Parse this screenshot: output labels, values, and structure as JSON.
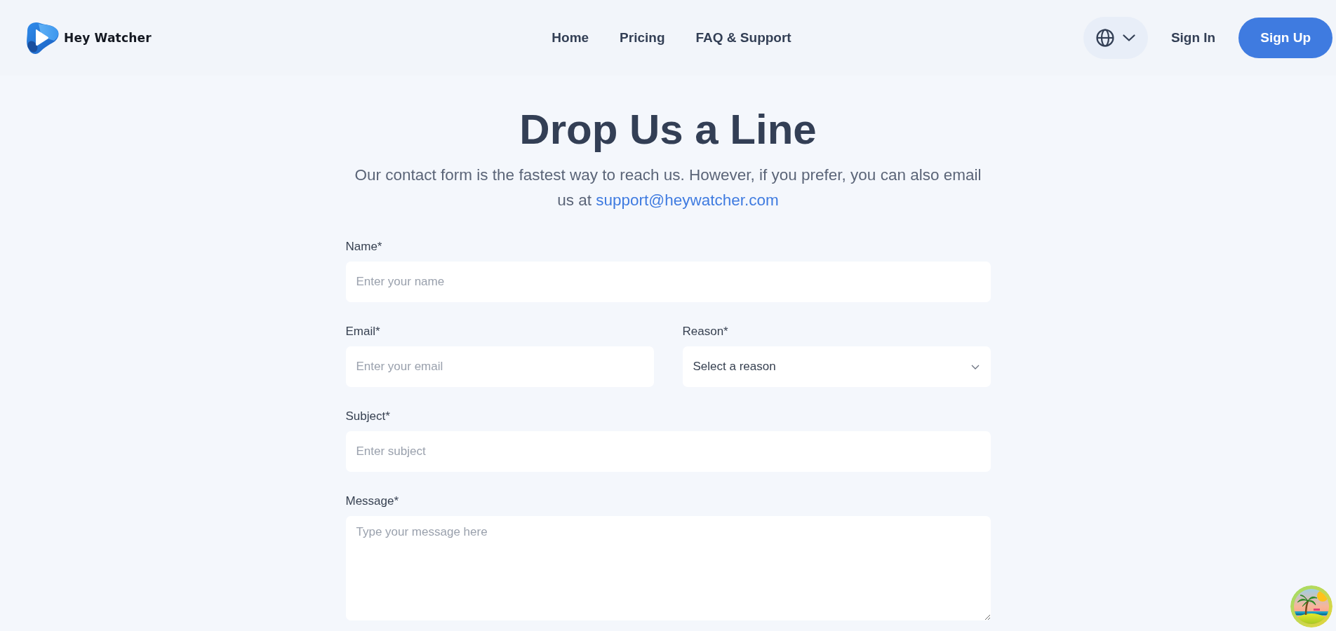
{
  "header": {
    "logo": {
      "text": "Hey Watcher"
    },
    "nav": [
      {
        "label": "Home"
      },
      {
        "label": "Pricing"
      },
      {
        "label": "FAQ & Support"
      }
    ],
    "sign_in": "Sign In",
    "sign_up": "Sign Up"
  },
  "contact": {
    "title": "Drop Us a Line",
    "intro": "Our contact form is the fastest way to reach us. However, if you prefer, you can also email us at ",
    "email": "support@heywatcher.com"
  },
  "form": {
    "rows": [
      {
        "fields": [
          {
            "kind": "input",
            "label": "Name*",
            "placeholder": "Enter your name"
          }
        ]
      },
      {
        "fields": [
          {
            "kind": "input",
            "label": "Email*",
            "placeholder": "Enter your email"
          },
          {
            "kind": "select",
            "label": "Reason*",
            "value": "Select a reason"
          }
        ]
      },
      {
        "fields": [
          {
            "kind": "input",
            "label": "Subject*",
            "placeholder": "Enter subject"
          }
        ]
      },
      {
        "fields": [
          {
            "kind": "textarea",
            "label": "Message*",
            "placeholder": "Type your message here"
          }
        ]
      }
    ]
  }
}
